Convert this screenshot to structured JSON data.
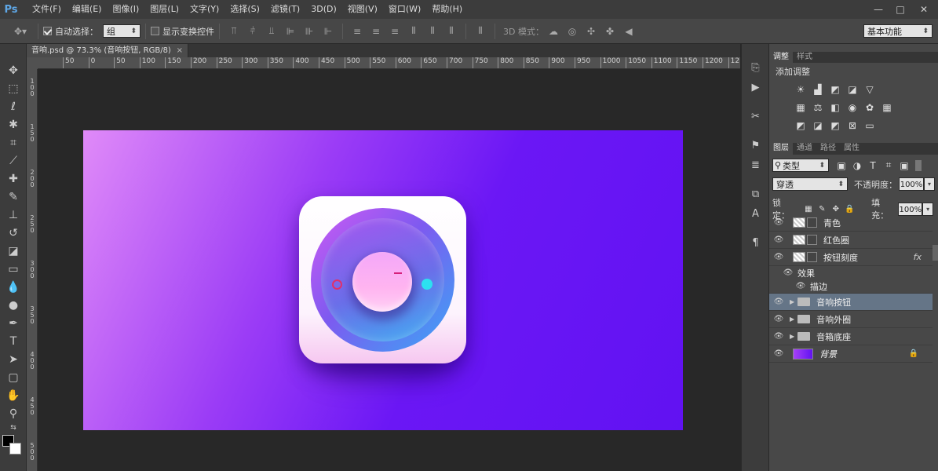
{
  "app": {
    "logo": "Ps"
  },
  "menu": [
    "文件(F)",
    "编辑(E)",
    "图像(I)",
    "图层(L)",
    "文字(Y)",
    "选择(S)",
    "滤镜(T)",
    "3D(D)",
    "视图(V)",
    "窗口(W)",
    "帮助(H)"
  ],
  "window_controls": {
    "minimize": "—",
    "restore": "□",
    "close": "✕"
  },
  "options": {
    "auto_select_label": "自动选择：",
    "auto_select_checked": true,
    "auto_select_value": "组",
    "show_transform_label": "显示变换控件",
    "show_transform_checked": false,
    "mode3d_label": "3D 模式：",
    "workspace": "基本功能"
  },
  "document": {
    "tab_title": "音响.psd @ 73.3% (音响按钮, RGB/8)",
    "close": "×"
  },
  "ruler": {
    "h_ticks": [
      "50",
      "0",
      "50",
      "100",
      "150",
      "200",
      "250",
      "300",
      "350",
      "400",
      "450",
      "500",
      "550",
      "600",
      "650",
      "700",
      "750",
      "800",
      "850",
      "900",
      "950",
      "1000",
      "1050",
      "1100",
      "1150",
      "1200",
      "12"
    ],
    "v_ticks": [
      "1",
      "0",
      "0",
      "1",
      "5",
      "0",
      "2",
      "0",
      "0",
      "2",
      "5",
      "0",
      "3",
      "0",
      "0",
      "3",
      "5",
      "0",
      "4",
      "0",
      "0",
      "4",
      "5",
      "0",
      "5",
      "0",
      "0"
    ]
  },
  "adjust_panel": {
    "tabs": [
      "调整",
      "样式"
    ],
    "title": "添加调整"
  },
  "layers_panel": {
    "tabs": [
      "图层",
      "通道",
      "路径",
      "属性"
    ],
    "filter_type": "类型",
    "blend_mode": "穿透",
    "opacity_label": "不透明度：",
    "opacity": "100%",
    "lock_label": "锁定：",
    "fill_label": "填充：",
    "fill": "100%",
    "layers": [
      {
        "name": "青色",
        "kind": "shape"
      },
      {
        "name": "红色圈",
        "kind": "shape"
      },
      {
        "name": "按钮刻度",
        "kind": "shape",
        "fx": "fx"
      },
      {
        "name": "效果",
        "kind": "effects"
      },
      {
        "name": "描边",
        "kind": "effect"
      },
      {
        "name": "音响按钮",
        "kind": "group",
        "selected": true
      },
      {
        "name": "音响外圈",
        "kind": "group"
      },
      {
        "name": "音箱底座",
        "kind": "group"
      },
      {
        "name": "背景",
        "kind": "background",
        "locked": true
      }
    ]
  },
  "colors": {
    "accent": "#5fa8e8",
    "selected_layer": "#657587",
    "artboard_start": "#e08af8",
    "artboard_end": "#6112f2",
    "cyan_dot": "#2ce0f0",
    "red_circle": "#e0306a"
  }
}
